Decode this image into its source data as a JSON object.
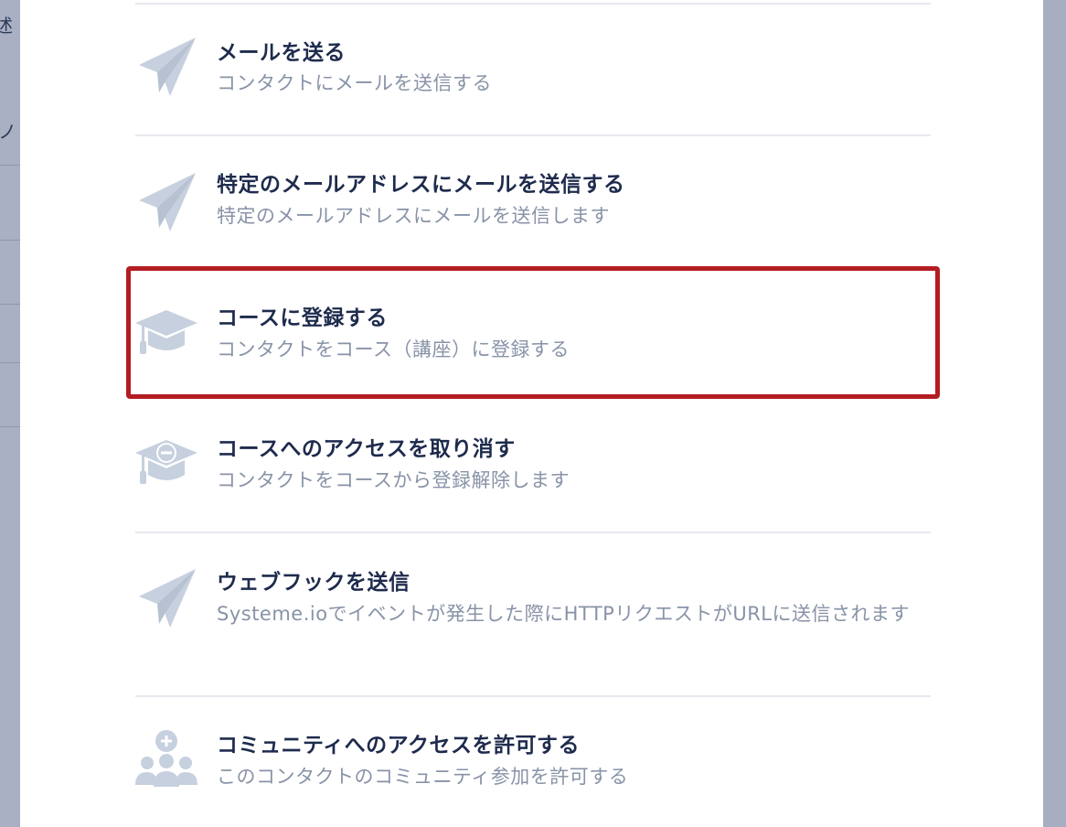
{
  "backdrop": {
    "glyph_top": "述",
    "glyph_mid": "ノ"
  },
  "colors": {
    "highlight": "#b31d22",
    "title": "#1e2b4d",
    "description": "#8893a7",
    "icon": "#c6d0de"
  },
  "actions": [
    {
      "icon": "paper-plane-icon",
      "title": "メールを送る",
      "description": "コンタクトにメールを送信する"
    },
    {
      "icon": "paper-plane-icon",
      "title": "特定のメールアドレスにメールを送信する",
      "description": "特定のメールアドレスにメールを送信します"
    },
    {
      "icon": "graduation-cap-icon",
      "title": "コースに登録する",
      "description": "コンタクトをコース（講座）に登録する",
      "highlighted": true
    },
    {
      "icon": "graduation-cap-minus-icon",
      "title": "コースへのアクセスを取り消す",
      "description": "コンタクトをコースから登録解除します"
    },
    {
      "icon": "paper-plane-icon",
      "title": "ウェブフックを送信",
      "description": "Systeme.ioでイベントが発生した際にHTTPリクエストがURLに送信されます"
    },
    {
      "icon": "community-add-icon",
      "title": "コミュニティへのアクセスを許可する",
      "description": "このコンタクトのコミュニティ参加を許可する"
    }
  ]
}
